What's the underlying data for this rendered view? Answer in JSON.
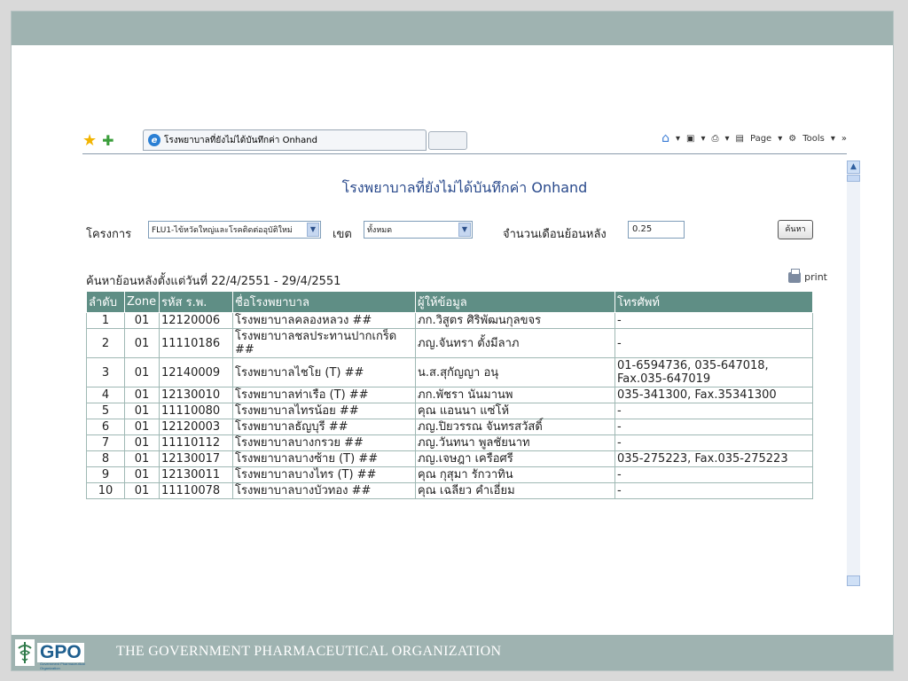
{
  "footer": {
    "logo_text": "GPO",
    "logo_subtext": "Government Pharmaceutical Organization",
    "org_name": "THE GOVERNMENT PHARMACEUTICAL ORGANIZATION"
  },
  "browser": {
    "tab_title": "โรงพยาบาลที่ยังไม่ได้บันทึกค่า Onhand",
    "menu": {
      "page": "Page",
      "tools": "Tools"
    }
  },
  "page": {
    "title": "โรงพยาบาลที่ยังไม่ได้บันทึกค่า Onhand",
    "filters": {
      "project_label": "โครงการ",
      "project_value": "FLU1-ไข้หวัดใหญ่และโรคติดต่ออุบัติใหม่",
      "zone_label": "เขต",
      "zone_value": "ทั้งหมด",
      "months_label": "จำนวนเดือนย้อนหลัง",
      "months_value": "0.25",
      "search_button": "ค้นหา"
    },
    "range_text": "ค้นหาย้อนหลังตั้งแต่วันที่ 22/4/2551 - 29/4/2551",
    "print_label": "print",
    "table": {
      "headers": [
        "ลำดับ",
        "Zone",
        "รหัส ร.พ.",
        "ชื่อโรงพยาบาล",
        "ผู้ให้ข้อมูล",
        "โทรศัพท์"
      ],
      "rows": [
        [
          "1",
          "01",
          "12120006",
          "โรงพยาบาลคลองหลวง ##",
          "ภก.วิสูตร ศิริพัฒนกุลขจร",
          "-"
        ],
        [
          "2",
          "01",
          "11110186",
          "โรงพยาบาลชลประทานปากเกร็ด ##",
          "ภญ.จันทรา ตั้งมีลาภ",
          "-"
        ],
        [
          "3",
          "01",
          "12140009",
          "โรงพยาบาลไชโย (T) ##",
          "น.ส.สุกัญญา อนุ",
          "01-6594736, 035-647018, Fax.035-647019"
        ],
        [
          "4",
          "01",
          "12130010",
          "โรงพยาบาลท่าเรือ (T) ##",
          "ภก.พัชรา นันมานพ",
          "035-341300, Fax.35341300"
        ],
        [
          "5",
          "01",
          "11110080",
          "โรงพยาบาลไทรน้อย ##",
          "คุณ แอนนา แซ่โห้",
          "-"
        ],
        [
          "6",
          "01",
          "12120003",
          "โรงพยาบาลธัญบุรี ##",
          "ภญ.ปิยวรรณ จันทรสวัสดิ์",
          "-"
        ],
        [
          "7",
          "01",
          "11110112",
          "โรงพยาบาลบางกรวย ##",
          "ภญ.วันทนา พูลชัยนาท",
          "-"
        ],
        [
          "8",
          "01",
          "12130017",
          "โรงพยาบาลบางซ้าย (T) ##",
          "ภญ.เจษฎา เครือศรี",
          "035-275223, Fax.035-275223"
        ],
        [
          "9",
          "01",
          "12130011",
          "โรงพยาบาลบางไทร (T) ##",
          "คุณ กุสุมา รักวาทิน",
          "-"
        ],
        [
          "10",
          "01",
          "11110078",
          "โรงพยาบาลบางบัวทอง ##",
          "คุณ เฉลียว คำเอี่ยม",
          "-"
        ]
      ]
    }
  },
  "colors": {
    "frame": "#9fb3b1",
    "table_header": "#5f8e85",
    "title": "#2a4a8c"
  }
}
